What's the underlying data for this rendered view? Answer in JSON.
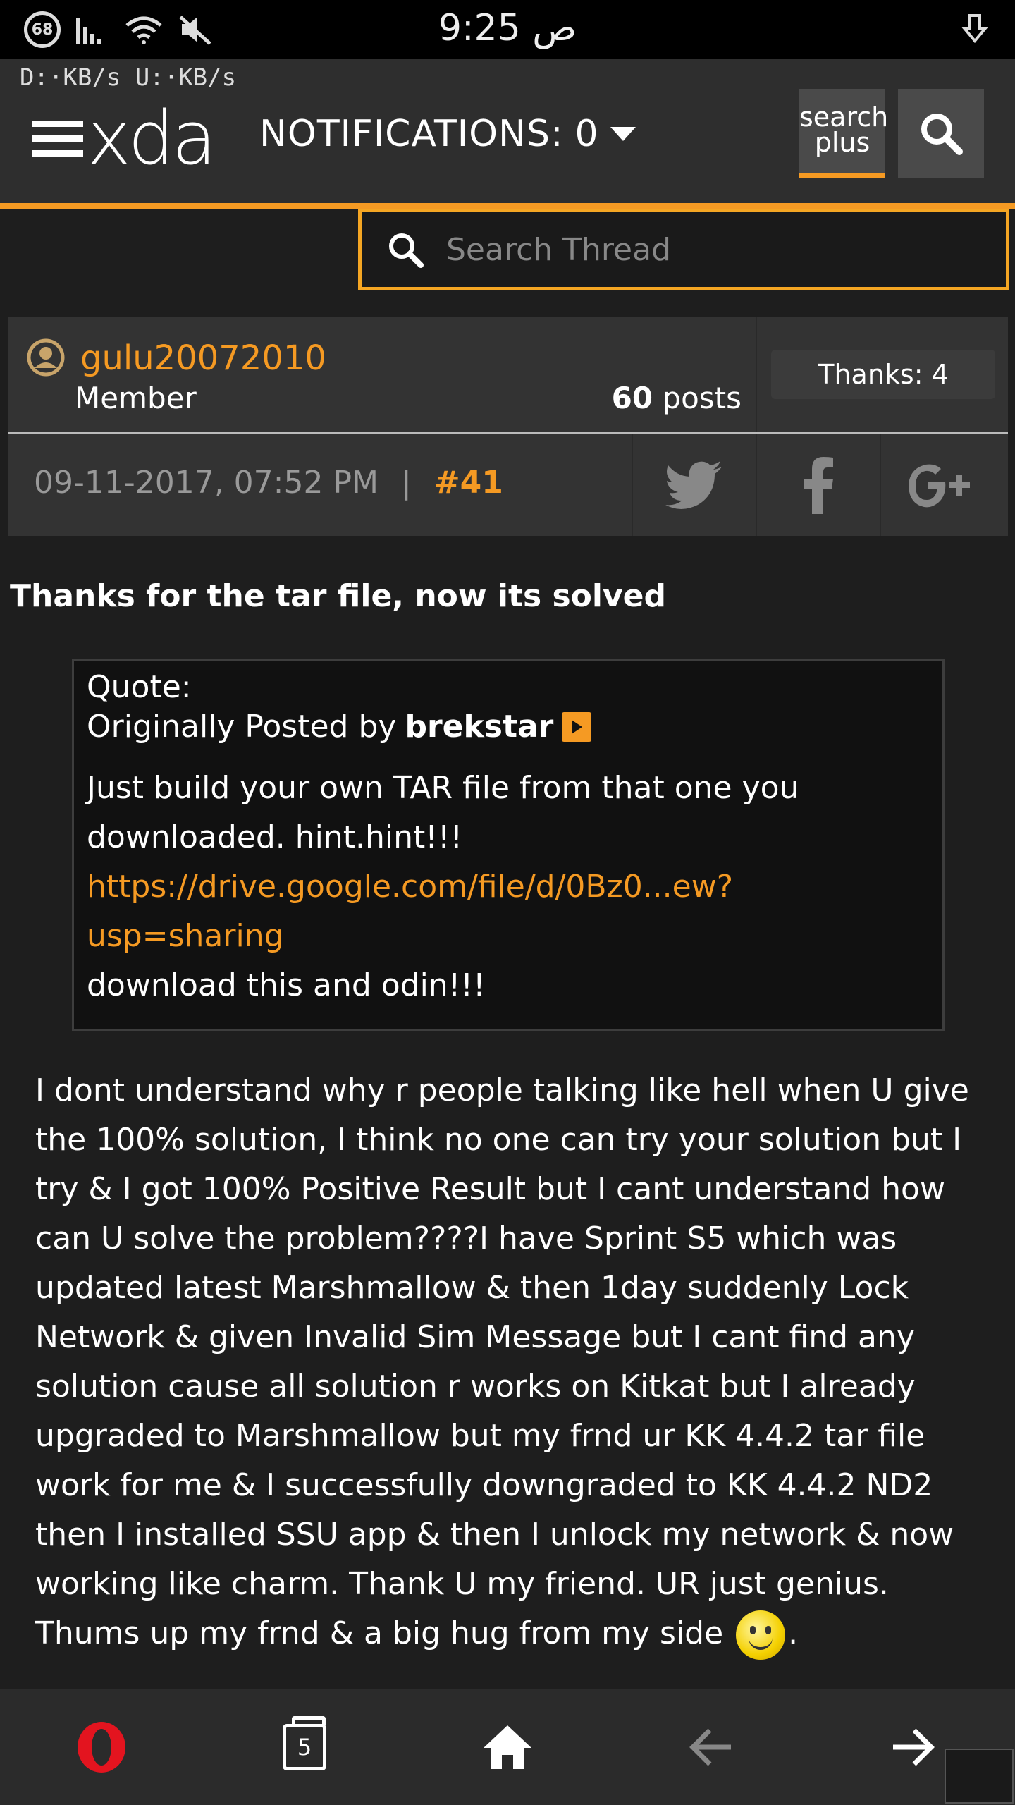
{
  "status_bar": {
    "battery": "68",
    "time": "9:25 ص"
  },
  "speed": "D:·KB/s  U:·KB/s",
  "header": {
    "logo_text": "xda",
    "notifications_label": "NOTIFICATIONS:",
    "notifications_count": "0",
    "search_plus_line1": "search",
    "search_plus_line2": "plus"
  },
  "thread_search": {
    "placeholder": "Search Thread"
  },
  "post": {
    "username": "gulu20072010",
    "role": "Member",
    "posts_count": "60",
    "posts_label": "posts",
    "thanks": "Thanks: 4",
    "date": "09-11-2017, 07:52 PM",
    "separator": "|",
    "number": "#41",
    "first_line": "Thanks for the tar file, now its solved",
    "quote": {
      "label": "Quote:",
      "originally_posted_by": "Originally Posted by",
      "author": "brekstar",
      "text": "Just build your own TAR file from that one you downloaded. hint.hint!!!",
      "link": "https://drive.google.com/file/d/0Bz0...ew?usp=sharing",
      "after_link": "download this and odin!!!"
    },
    "body": "I dont understand why r people talking like hell when U give the 100% solution, I think no one can try your solution but I try & I got 100% Positive Result but I cant understand how can U solve the problem????I have Sprint S5 which was updated latest Marshmallow & then 1day suddenly Lock Network & given Invalid Sim Message but I cant find any solution cause all solution r works on Kitkat but I already upgraded to Marshmallow but my frnd ur KK 4.4.2 tar file work for me & I successfully downgraded to KK 4.4.2 ND2 then I installed SSU app & then I unlock my network & now working like charm. Thank U my friend. UR just genius. Thums up my frnd & a big hug from my side",
    "body_end": "."
  },
  "bottom_nav": {
    "tabs_count": "5"
  },
  "colors": {
    "accent": "#f59a23",
    "opera_red": "#e3141f"
  }
}
